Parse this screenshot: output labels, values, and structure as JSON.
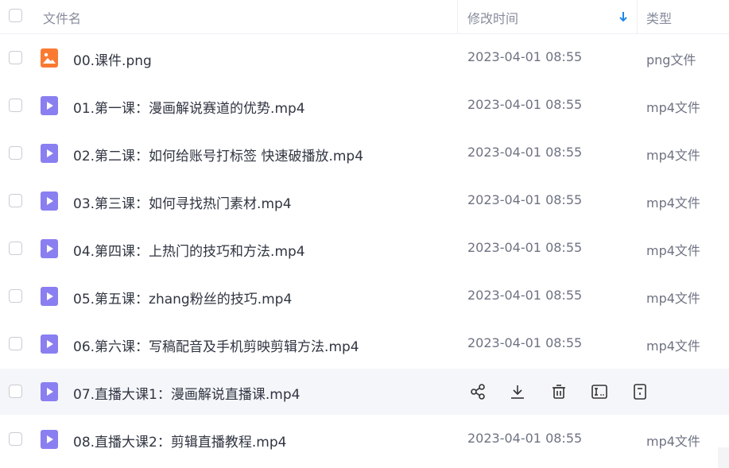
{
  "header": {
    "col_name": "文件名",
    "col_time": "修改时间",
    "col_type": "类型",
    "sort_icon": "arrow-down-icon",
    "accent_color": "#1e88e5"
  },
  "files": [
    {
      "name": "00.课件.png",
      "time": "2023-04-01 08:55",
      "type": "png文件",
      "icon": "image-file-icon"
    },
    {
      "name": "01.第一课：漫画解说赛道的优势.mp4",
      "time": "2023-04-01 08:55",
      "type": "mp4文件",
      "icon": "video-file-icon"
    },
    {
      "name": "02.第二课：如何给账号打标签 快速破播放.mp4",
      "time": "2023-04-01 08:55",
      "type": "mp4文件",
      "icon": "video-file-icon"
    },
    {
      "name": "03.第三课：如何寻找热门素材.mp4",
      "time": "2023-04-01 08:55",
      "type": "mp4文件",
      "icon": "video-file-icon"
    },
    {
      "name": "04.第四课：上热门的技巧和方法.mp4",
      "time": "2023-04-01 08:55",
      "type": "mp4文件",
      "icon": "video-file-icon"
    },
    {
      "name": "05.第五课：zhang粉丝的技巧.mp4",
      "time": "2023-04-01 08:55",
      "type": "mp4文件",
      "icon": "video-file-icon"
    },
    {
      "name": "06.第六课：写稿配音及手机剪映剪辑方法.mp4",
      "time": "2023-04-01 08:55",
      "type": "mp4文件",
      "icon": "video-file-icon"
    },
    {
      "name": "07.直播大课1：漫画解说直播课.mp4",
      "time": "",
      "type": "",
      "icon": "video-file-icon"
    },
    {
      "name": "08.直播大课2：剪辑直播教程.mp4",
      "time": "2023-04-01 08:55",
      "type": "mp4文件",
      "icon": "video-file-icon"
    }
  ],
  "hover_actions": [
    "share-icon",
    "download-icon",
    "delete-icon",
    "rename-icon",
    "more-info-icon"
  ],
  "colors": {
    "image_icon": "#fa7a32",
    "video_icon": "#8a7ff0",
    "hover_row": "#f5f6fa"
  }
}
